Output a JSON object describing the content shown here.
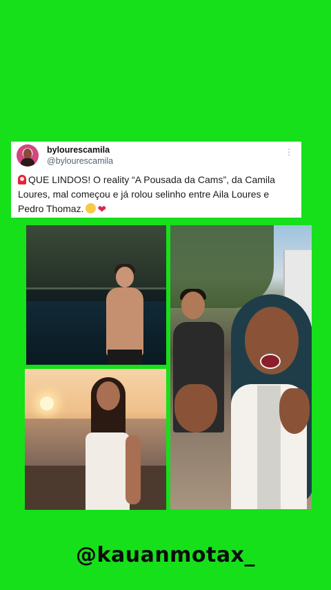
{
  "tweet": {
    "display_name": "bylourescamila",
    "handle": "@bylourescamila",
    "more_icon": "⋮",
    "text": "QUE LINDOS! O reality “A Pousada da Cams”, da Camila Loures, mal começou e já rolou selinho entre Aila Loures e Pedro Thomaz."
  },
  "watermark": "@kauanmotax_",
  "colors": {
    "background": "#16e01a",
    "card": "#ffffff",
    "handle": "#536471"
  }
}
